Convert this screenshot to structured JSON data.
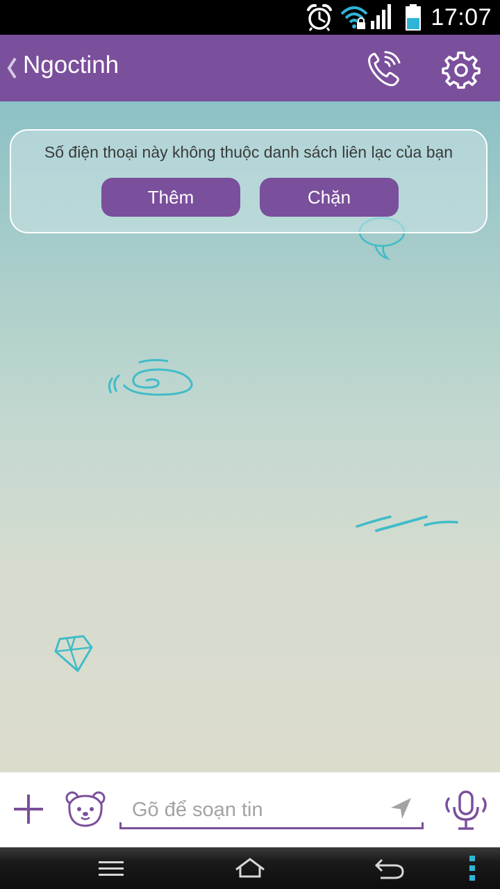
{
  "status_bar": {
    "time": "17:07",
    "icons": [
      "alarm-icon",
      "wifi-icon",
      "signal-icon",
      "battery-icon"
    ]
  },
  "header": {
    "contact_name": "Ngoctinh",
    "icons": [
      "back-chevron-icon",
      "viber-call-icon",
      "gear-icon"
    ]
  },
  "notice": {
    "text": "Số điện thoại này không thuộc danh sách liên lạc của bạn",
    "add_label": "Thêm",
    "block_label": "Chặn"
  },
  "composer": {
    "placeholder": "Gõ để soạn tin",
    "value": "",
    "icons": [
      "plus-icon",
      "bear-sticker-icon",
      "send-arrow-icon",
      "microphone-icon"
    ]
  },
  "nav": {
    "icons": [
      "menu-icon",
      "home-icon",
      "back-icon",
      "overflow-icon"
    ]
  },
  "colors": {
    "brand": "#7a4f9b",
    "doodle": "#3fbcc8",
    "placeholder": "#a3a3a3"
  }
}
